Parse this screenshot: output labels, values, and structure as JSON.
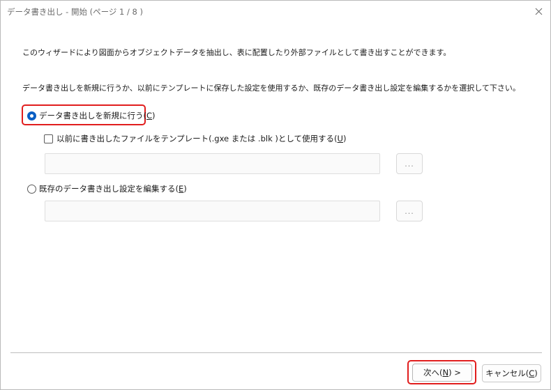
{
  "window": {
    "title": "データ書き出し - 開始 (ページ 1 / 8 )"
  },
  "body": {
    "intro": "このウィザードにより図面からオブジェクトデータを抽出し、表に配置したり外部ファイルとして書き出すことができます。",
    "instruction": "データ書き出しを新規に行うか、以前にテンプレートに保存した設定を使用するか、既存のデータ書き出し設定を編集するかを選択して下さい。"
  },
  "options": {
    "new_label": "データ書き出しを新規に行う(",
    "new_mnemonic": "C",
    "new_suffix": ")",
    "new_checked": true,
    "template_label": "以前に書き出したファイルをテンプレート(.gxe または .blk )として使用する(",
    "template_mnemonic": "U",
    "template_suffix": ")",
    "template_checked": false,
    "template_path": "",
    "browse_label": "...",
    "edit_label": "既存のデータ書き出し設定を編集する(",
    "edit_mnemonic": "E",
    "edit_suffix": ")",
    "edit_checked": false,
    "edit_path": ""
  },
  "footer": {
    "next_label": "次へ(",
    "next_mnemonic": "N",
    "next_suffix": ") >",
    "cancel_label": "キャンセル(",
    "cancel_mnemonic": "C",
    "cancel_suffix": ")"
  },
  "colors": {
    "highlight": "#e11d1d",
    "accent": "#0a5fc4"
  }
}
